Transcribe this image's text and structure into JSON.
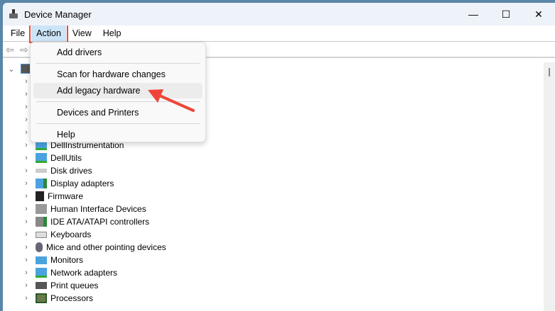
{
  "window": {
    "title": "Device Manager",
    "minimize": "—",
    "maximize": "☐",
    "close": "✕"
  },
  "menubar": [
    "File",
    "Action",
    "View",
    "Help"
  ],
  "action_menu": {
    "items": [
      "Add drivers",
      "Scan for hardware changes",
      "Add legacy hardware",
      "Devices and Printers",
      "Help"
    ],
    "highlighted": "Add legacy hardware"
  },
  "tree": {
    "items": [
      "DellInstrumentation",
      "DellUtils",
      "Disk drives",
      "Display adapters",
      "Firmware",
      "Human Interface Devices",
      "IDE ATA/ATAPI controllers",
      "Keyboards",
      "Mice and other pointing devices",
      "Monitors",
      "Network adapters",
      "Print queues",
      "Processors"
    ]
  },
  "colors": {
    "highlight_box": "#e74c3c",
    "arrow": "#ef4438",
    "menu_active": "#cce4f7"
  }
}
